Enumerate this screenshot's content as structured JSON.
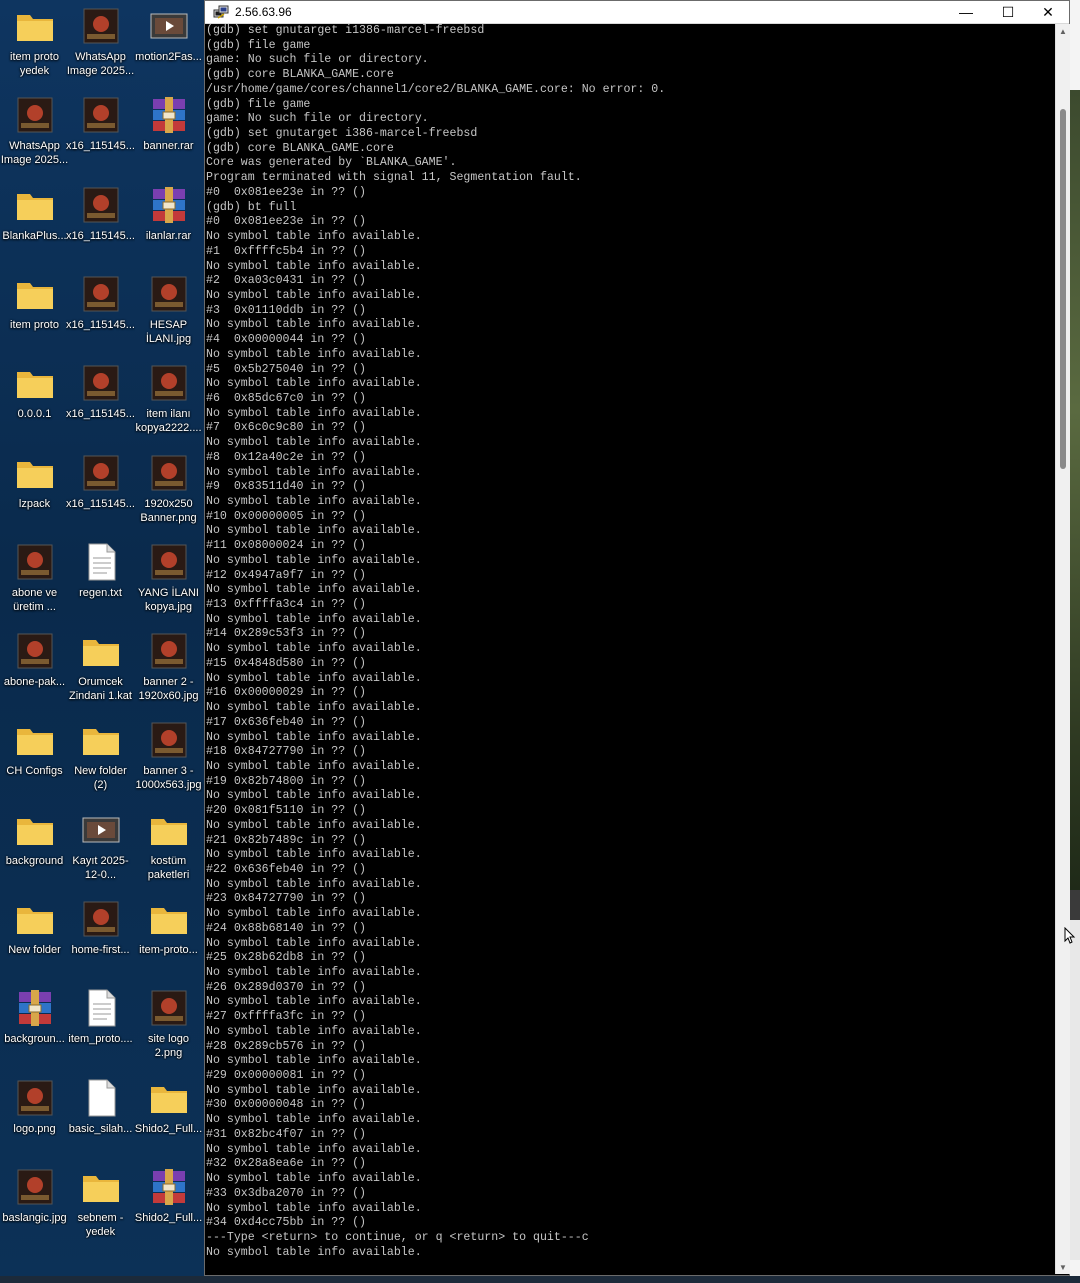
{
  "window": {
    "title": "2.56.63.96",
    "controls": {
      "minimize": "—",
      "maximize": "☐",
      "close": "✕"
    }
  },
  "desktop_icons": [
    {
      "label": "item proto yedek",
      "icon": "folder-icon"
    },
    {
      "label": "WhatsApp Image 2025...",
      "icon": "image-icon"
    },
    {
      "label": "motion2Fas...",
      "icon": "video-icon"
    },
    {
      "label": "WhatsApp Image 2025...",
      "icon": "image-icon"
    },
    {
      "label": "x16_115145...",
      "icon": "image-icon"
    },
    {
      "label": "banner.rar",
      "icon": "archive-icon"
    },
    {
      "label": "BlankaPlus...",
      "icon": "folder-icon"
    },
    {
      "label": "x16_115145...",
      "icon": "image-icon"
    },
    {
      "label": "ilanlar.rar",
      "icon": "archive-icon"
    },
    {
      "label": "item proto",
      "icon": "folder-icon"
    },
    {
      "label": "x16_115145...",
      "icon": "image-icon"
    },
    {
      "label": "HESAP İLANI.jpg",
      "icon": "image-icon"
    },
    {
      "label": "0.0.0.1",
      "icon": "folder-icon"
    },
    {
      "label": "x16_115145...",
      "icon": "image-icon"
    },
    {
      "label": "item ilanı kopya2222....",
      "icon": "image-icon"
    },
    {
      "label": "lzpack",
      "icon": "folder-icon"
    },
    {
      "label": "x16_115145...",
      "icon": "image-icon"
    },
    {
      "label": "1920x250 Banner.png",
      "icon": "image-icon"
    },
    {
      "label": "abone ve üretim ...",
      "icon": "image-icon"
    },
    {
      "label": "regen.txt",
      "icon": "text-file-icon"
    },
    {
      "label": "YANG İLANI kopya.jpg",
      "icon": "image-icon"
    },
    {
      "label": "abone-pak...",
      "icon": "image-icon"
    },
    {
      "label": "Orumcek Zindani 1.kat",
      "icon": "folder-icon"
    },
    {
      "label": "banner 2 - 1920x60.jpg",
      "icon": "image-icon"
    },
    {
      "label": "CH Configs",
      "icon": "folder-icon"
    },
    {
      "label": "New folder (2)",
      "icon": "folder-icon"
    },
    {
      "label": "banner 3 - 1000x563.jpg",
      "icon": "image-icon"
    },
    {
      "label": "background",
      "icon": "folder-icon"
    },
    {
      "label": "Kayıt 2025-12-0...",
      "icon": "video-icon"
    },
    {
      "label": "kostüm paketleri",
      "icon": "folder-icon"
    },
    {
      "label": "New folder",
      "icon": "folder-icon"
    },
    {
      "label": "home-first...",
      "icon": "image-icon"
    },
    {
      "label": "item-proto...",
      "icon": "folder-icon"
    },
    {
      "label": "backgroun...",
      "icon": "archive-icon"
    },
    {
      "label": "item_proto....",
      "icon": "text-file-icon"
    },
    {
      "label": "site logo 2.png",
      "icon": "image-icon"
    },
    {
      "label": "logo.png",
      "icon": "image-icon"
    },
    {
      "label": "basic_silah...",
      "icon": "blank-file-icon"
    },
    {
      "label": "Shido2_Full...",
      "icon": "folder-icon"
    },
    {
      "label": "baslangic.jpg",
      "icon": "image-icon"
    },
    {
      "label": "sebnem - yedek",
      "icon": "folder-icon"
    },
    {
      "label": "Shido2_Full...",
      "icon": "archive-icon"
    }
  ],
  "console": {
    "lines": [
      "(gdb) set gnutarget i1386-marcel-freebsd",
      "(gdb) file game",
      "game: No such file or directory.",
      "(gdb) core BLANKA_GAME.core",
      "/usr/home/game/cores/channel1/core2/BLANKA_GAME.core: No error: 0.",
      "(gdb) file game",
      "game: No such file or directory.",
      "(gdb) set gnutarget i386-marcel-freebsd",
      "(gdb) core BLANKA_GAME.core",
      "Core was generated by `BLANKA_GAME'.",
      "Program terminated with signal 11, Segmentation fault.",
      "#0  0x081ee23e in ?? ()",
      "(gdb) bt full",
      "#0  0x081ee23e in ?? ()",
      "No symbol table info available.",
      "#1  0xffffc5b4 in ?? ()",
      "No symbol table info available.",
      "#2  0xa03c0431 in ?? ()",
      "No symbol table info available.",
      "#3  0x01110ddb in ?? ()",
      "No symbol table info available.",
      "#4  0x00000044 in ?? ()",
      "No symbol table info available.",
      "#5  0x5b275040 in ?? ()",
      "No symbol table info available.",
      "#6  0x85dc67c0 in ?? ()",
      "No symbol table info available.",
      "#7  0x6c0c9c80 in ?? ()",
      "No symbol table info available.",
      "#8  0x12a40c2e in ?? ()",
      "No symbol table info available.",
      "#9  0x83511d40 in ?? ()",
      "No symbol table info available.",
      "#10 0x00000005 in ?? ()",
      "No symbol table info available.",
      "#11 0x08000024 in ?? ()",
      "No symbol table info available.",
      "#12 0x4947a9f7 in ?? ()",
      "No symbol table info available.",
      "#13 0xffffa3c4 in ?? ()",
      "No symbol table info available.",
      "#14 0x289c53f3 in ?? ()",
      "No symbol table info available.",
      "#15 0x4848d580 in ?? ()",
      "No symbol table info available.",
      "#16 0x00000029 in ?? ()",
      "No symbol table info available.",
      "#17 0x636feb40 in ?? ()",
      "No symbol table info available.",
      "#18 0x84727790 in ?? ()",
      "No symbol table info available.",
      "#19 0x82b74800 in ?? ()",
      "No symbol table info available.",
      "#20 0x081f5110 in ?? ()",
      "No symbol table info available.",
      "#21 0x82b7489c in ?? ()",
      "No symbol table info available.",
      "#22 0x636feb40 in ?? ()",
      "No symbol table info available.",
      "#23 0x84727790 in ?? ()",
      "No symbol table info available.",
      "#24 0x88b68140 in ?? ()",
      "No symbol table info available.",
      "#25 0x28b62db8 in ?? ()",
      "No symbol table info available.",
      "#26 0x289d0370 in ?? ()",
      "No symbol table info available.",
      "#27 0xffffa3fc in ?? ()",
      "No symbol table info available.",
      "#28 0x289cb576 in ?? ()",
      "No symbol table info available.",
      "#29 0x00000081 in ?? ()",
      "No symbol table info available.",
      "#30 0x00000048 in ?? ()",
      "No symbol table info available.",
      "#31 0x82bc4f07 in ?? ()",
      "No symbol table info available.",
      "#32 0x28a8ea6e in ?? ()",
      "No symbol table info available.",
      "#33 0x3dba2070 in ?? ()",
      "No symbol table info available.",
      "#34 0xd4cc75bb in ?? ()",
      "---Type <return> to continue, or q <return> to quit---c",
      "No symbol table info available."
    ]
  },
  "colors": {
    "console_bg": "#000000",
    "console_fg": "#c6c6c6",
    "titlebar_bg": "#ffffff",
    "desktop_bg": "#0c3157",
    "folder": "#f5c242"
  }
}
